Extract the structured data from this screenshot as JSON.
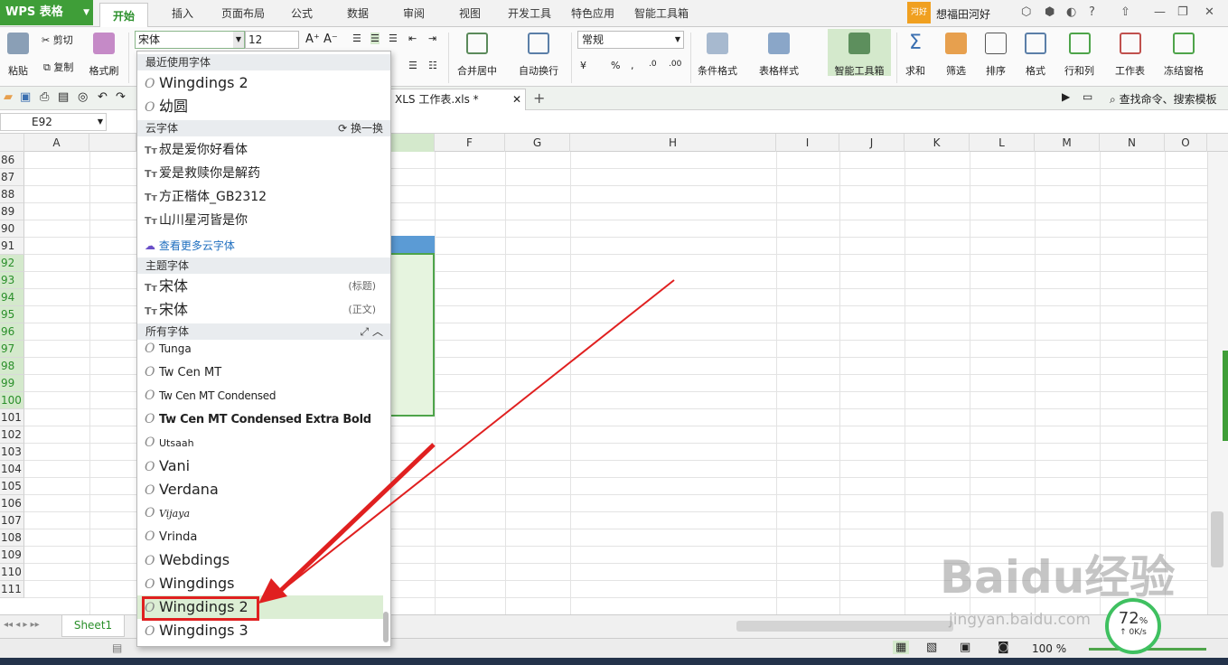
{
  "app": {
    "logo": "WPS 表格"
  },
  "menu": {
    "tabs": [
      "开始",
      "插入",
      "页面布局",
      "公式",
      "数据",
      "审阅",
      "视图",
      "开发工具",
      "特色应用",
      "智能工具箱"
    ]
  },
  "user": {
    "badge": "河好",
    "name": "想福田河好"
  },
  "ribbon": {
    "paste": "粘贴",
    "cut": "剪切",
    "copy": "复制",
    "format_painter": "格式刷",
    "font_name": "宋体",
    "font_size": "12",
    "merge_center": "合并居中",
    "wrap_text": "自动换行",
    "number_format": "常规",
    "cond_format": "条件格式",
    "table_style": "表格样式",
    "smart_toolbox": "智能工具箱",
    "sum": "求和",
    "filter": "筛选",
    "sort": "排序",
    "format": "格式",
    "rows_cols": "行和列",
    "worksheet": "工作表",
    "freeze": "冻结窗格"
  },
  "doc_tab": {
    "title": "XLS 工作表.xls *",
    "search_cmd": "查找命令、搜索模板"
  },
  "formula": {
    "cell_ref": "E92"
  },
  "grid": {
    "columns": [
      "A",
      "F",
      "G",
      "H",
      "I",
      "J",
      "K",
      "L",
      "M",
      "N",
      "O"
    ],
    "rows": [
      "86",
      "87",
      "88",
      "89",
      "90",
      "91",
      "92",
      "93",
      "94",
      "95",
      "96",
      "97",
      "98",
      "99",
      "100",
      "101",
      "102",
      "103",
      "104",
      "105",
      "106",
      "107",
      "108",
      "109",
      "110",
      "111"
    ]
  },
  "sheet": {
    "tab": "Sheet1"
  },
  "status": {
    "zoom": "100 %"
  },
  "speed": {
    "percent": "72",
    "percent_sign": "%",
    "rate": "0K/s"
  },
  "watermark": {
    "brand": "Baidu经验",
    "url": "jingyan.baidu.com"
  },
  "font_dropdown": {
    "recent_header": "最近使用字体",
    "recent": [
      "Wingdings 2",
      "幼圆"
    ],
    "cloud_header": "云字体",
    "cloud_refresh": "换一换",
    "cloud_fonts": [
      "叔是爱你好看体",
      "爱是救赎你是解药",
      "方正楷体_GB2312",
      "山川星河皆是你"
    ],
    "more_cloud": "查看更多云字体",
    "theme_header": "主题字体",
    "theme": [
      {
        "name": "宋体",
        "tag": "(标题)"
      },
      {
        "name": "宋体",
        "tag": "(正文)"
      }
    ],
    "all_header": "所有字体",
    "all_fonts": [
      "Tunga",
      "Tw Cen MT",
      "Tw Cen MT Condensed",
      "Tw Cen MT Condensed Extra Bold",
      "Utsaah",
      "Vani",
      "Verdana",
      "Vijaya",
      "Vrinda",
      "Webdings",
      "Wingdings",
      "Wingdings 2",
      "Wingdings 3"
    ],
    "highlighted": "Wingdings 2"
  },
  "colors": {
    "accent": "#3f9e38",
    "selection": "#e6f4df",
    "annotation": "#e02020"
  }
}
